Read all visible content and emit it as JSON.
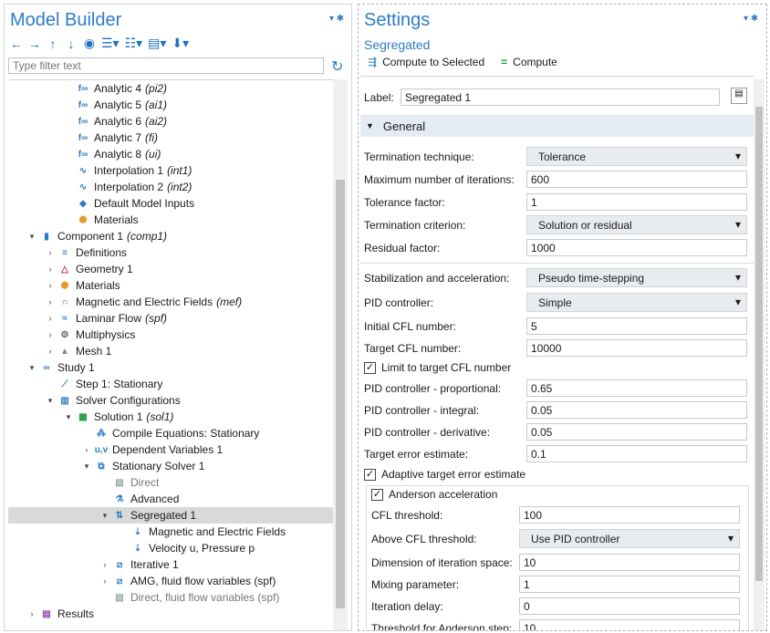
{
  "model_builder": {
    "title": "Model Builder",
    "filter_placeholder": "Type filter text",
    "tree": [
      {
        "label": "Analytic 4",
        "tag": "(pi2)",
        "icon": "function-icon",
        "level": 3
      },
      {
        "label": "Analytic 5",
        "tag": "(ai1)",
        "icon": "function-icon",
        "level": 3
      },
      {
        "label": "Analytic 6",
        "tag": "(ai2)",
        "icon": "function-icon",
        "level": 3
      },
      {
        "label": "Analytic 7",
        "tag": "(fi)",
        "icon": "function-icon",
        "level": 3
      },
      {
        "label": "Analytic 8",
        "tag": "(ui)",
        "icon": "function-icon",
        "level": 3
      },
      {
        "label": "Interpolation 1",
        "tag": "(int1)",
        "icon": "interpolation-icon",
        "level": 3
      },
      {
        "label": "Interpolation 2",
        "tag": "(int2)",
        "icon": "interpolation-icon",
        "level": 3
      },
      {
        "label": "Default Model Inputs",
        "tag": "",
        "icon": "model-inputs-icon",
        "level": 3
      },
      {
        "label": "Materials",
        "tag": "",
        "icon": "materials-icon",
        "level": 3
      },
      {
        "label": "Component 1",
        "tag": "(comp1)",
        "icon": "component-icon",
        "level": 1,
        "arrow": "▾"
      },
      {
        "label": "Definitions",
        "tag": "",
        "icon": "definitions-icon",
        "level": 2,
        "arrow": "›"
      },
      {
        "label": "Geometry 1",
        "tag": "",
        "icon": "geometry-icon",
        "level": 2,
        "arrow": "›"
      },
      {
        "label": "Materials",
        "tag": "",
        "icon": "materials-icon",
        "level": 2,
        "arrow": "›"
      },
      {
        "label": "Magnetic and Electric Fields",
        "tag": "(mef)",
        "icon": "magnet-icon",
        "level": 2,
        "arrow": "›"
      },
      {
        "label": "Laminar Flow",
        "tag": "(spf)",
        "icon": "flow-icon",
        "level": 2,
        "arrow": "›"
      },
      {
        "label": "Multiphysics",
        "tag": "",
        "icon": "multiphysics-icon",
        "level": 2,
        "arrow": "›"
      },
      {
        "label": "Mesh 1",
        "tag": "",
        "icon": "mesh-icon",
        "level": 2,
        "arrow": "›"
      },
      {
        "label": "Study 1",
        "tag": "",
        "icon": "study-icon",
        "level": 1,
        "arrow": "▾"
      },
      {
        "label": "Step 1: Stationary",
        "tag": "",
        "icon": "step-icon",
        "level": 2
      },
      {
        "label": "Solver Configurations",
        "tag": "",
        "icon": "solver-config-icon",
        "level": 2,
        "arrow": "▾"
      },
      {
        "label": "Solution 1",
        "tag": "(sol1)",
        "icon": "solution-icon",
        "level": 3,
        "arrow": "▾"
      },
      {
        "label": "Compile Equations: Stationary",
        "tag": "",
        "icon": "compile-icon",
        "level": 4
      },
      {
        "label": "Dependent Variables 1",
        "tag": "",
        "icon": "variables-icon",
        "level": 4,
        "arrow": "›"
      },
      {
        "label": "Stationary Solver 1",
        "tag": "",
        "icon": "stationary-solver-icon",
        "level": 4,
        "arrow": "▾"
      },
      {
        "label": "Direct",
        "tag": "",
        "icon": "direct-icon",
        "level": 5,
        "dim": true
      },
      {
        "label": "Advanced",
        "tag": "",
        "icon": "advanced-icon",
        "level": 5
      },
      {
        "label": "Segregated 1",
        "tag": "",
        "icon": "segregated-icon",
        "level": 5,
        "arrow": "▾",
        "selected": true
      },
      {
        "label": "Magnetic and Electric Fields",
        "tag": "",
        "icon": "segregated-step-icon",
        "level": 6
      },
      {
        "label": "Velocity u, Pressure p",
        "tag": "",
        "icon": "segregated-step-icon",
        "level": 6
      },
      {
        "label": "Iterative 1",
        "tag": "",
        "icon": "iterative-icon",
        "level": 5,
        "arrow": "›"
      },
      {
        "label": "AMG, fluid flow variables (spf)",
        "tag": "",
        "icon": "iterative-icon",
        "level": 5,
        "arrow": "›"
      },
      {
        "label": "Direct, fluid flow variables (spf)",
        "tag": "",
        "icon": "direct-icon",
        "level": 5,
        "dim": true
      },
      {
        "label": "Results",
        "tag": "",
        "icon": "results-icon",
        "level": 1,
        "arrow": "›"
      }
    ]
  },
  "settings": {
    "title": "Settings",
    "subtitle": "Segregated",
    "compute_selected": "Compute to Selected",
    "compute": "Compute",
    "label_caption": "Label:",
    "label_value": "Segregated 1",
    "section_general": "General",
    "termination_technique": {
      "label": "Termination technique:",
      "value": "Tolerance"
    },
    "max_iterations": {
      "label": "Maximum number of iterations:",
      "value": "600"
    },
    "tolerance_factor": {
      "label": "Tolerance factor:",
      "value": "1"
    },
    "termination_criterion": {
      "label": "Termination criterion:",
      "value": "Solution or residual"
    },
    "residual_factor": {
      "label": "Residual factor:",
      "value": "1000"
    },
    "stabilization": {
      "label": "Stabilization and acceleration:",
      "value": "Pseudo time-stepping"
    },
    "pid_controller": {
      "label": "PID controller:",
      "value": "Simple"
    },
    "initial_cfl": {
      "label": "Initial CFL number:",
      "value": "5"
    },
    "target_cfl": {
      "label": "Target CFL number:",
      "value": "10000"
    },
    "limit_cfl": {
      "label": "Limit to target CFL number",
      "checked": true
    },
    "pid_prop": {
      "label": "PID controller - proportional:",
      "value": "0.65"
    },
    "pid_int": {
      "label": "PID controller - integral:",
      "value": "0.05"
    },
    "pid_der": {
      "label": "PID controller - derivative:",
      "value": "0.05"
    },
    "target_error": {
      "label": "Target error estimate:",
      "value": "0.1"
    },
    "adaptive_error": {
      "label": "Adaptive target error estimate",
      "checked": true
    },
    "anderson": {
      "label": "Anderson acceleration",
      "checked": true
    },
    "cfl_threshold": {
      "label": "CFL threshold:",
      "value": "100"
    },
    "above_cfl": {
      "label": "Above CFL threshold:",
      "value": "Use PID controller"
    },
    "dim_iter": {
      "label": "Dimension of iteration space:",
      "value": "10"
    },
    "mixing": {
      "label": "Mixing parameter:",
      "value": "1"
    },
    "iter_delay": {
      "label": "Iteration delay:",
      "value": "0"
    },
    "threshold_anderson": {
      "label": "Threshold for Anderson step:",
      "value": "10"
    }
  }
}
